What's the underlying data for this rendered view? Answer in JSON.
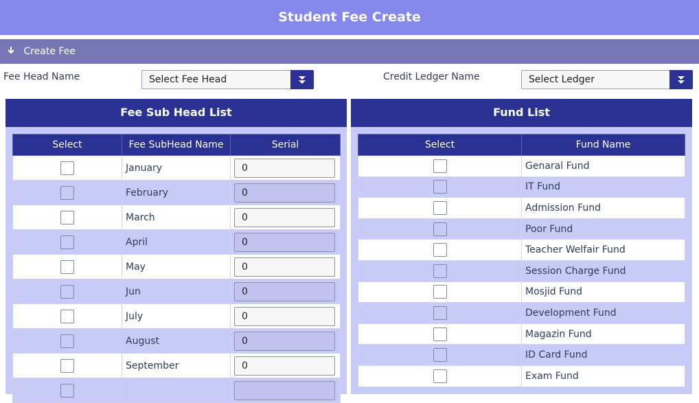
{
  "header": {
    "title": "Student Fee Create"
  },
  "section": {
    "title": "Create Fee",
    "icon": "arrow-down-icon"
  },
  "form": {
    "fee_head_label": "Fee Head Name",
    "fee_head_value": "Select Fee Head",
    "ledger_label": "Credit Ledger Name",
    "ledger_value": "Select Ledger"
  },
  "fee_sub_head_list": {
    "title": "Fee Sub Head List",
    "columns": [
      "Select",
      "Fee SubHead Name",
      "Serial"
    ],
    "rows": [
      {
        "name": "January",
        "serial": "0"
      },
      {
        "name": "February",
        "serial": "0"
      },
      {
        "name": "March",
        "serial": "0"
      },
      {
        "name": "April",
        "serial": "0"
      },
      {
        "name": "May",
        "serial": "0"
      },
      {
        "name": "Jun",
        "serial": "0"
      },
      {
        "name": "July",
        "serial": "0"
      },
      {
        "name": "August",
        "serial": "0"
      },
      {
        "name": "September",
        "serial": "0"
      },
      {
        "name": "",
        "serial": ""
      }
    ]
  },
  "fund_list": {
    "title": "Fund List",
    "columns": [
      "Select",
      "Fund Name"
    ],
    "rows": [
      "Genaral Fund",
      "IT Fund",
      "Admission Fund",
      "Poor Fund",
      "Teacher Welfair Fund",
      "Session Charge Fund",
      "Mosjid Fund",
      "Development Fund",
      "Magazin Fund",
      "ID Card Fund",
      "Exam Fund"
    ]
  }
}
